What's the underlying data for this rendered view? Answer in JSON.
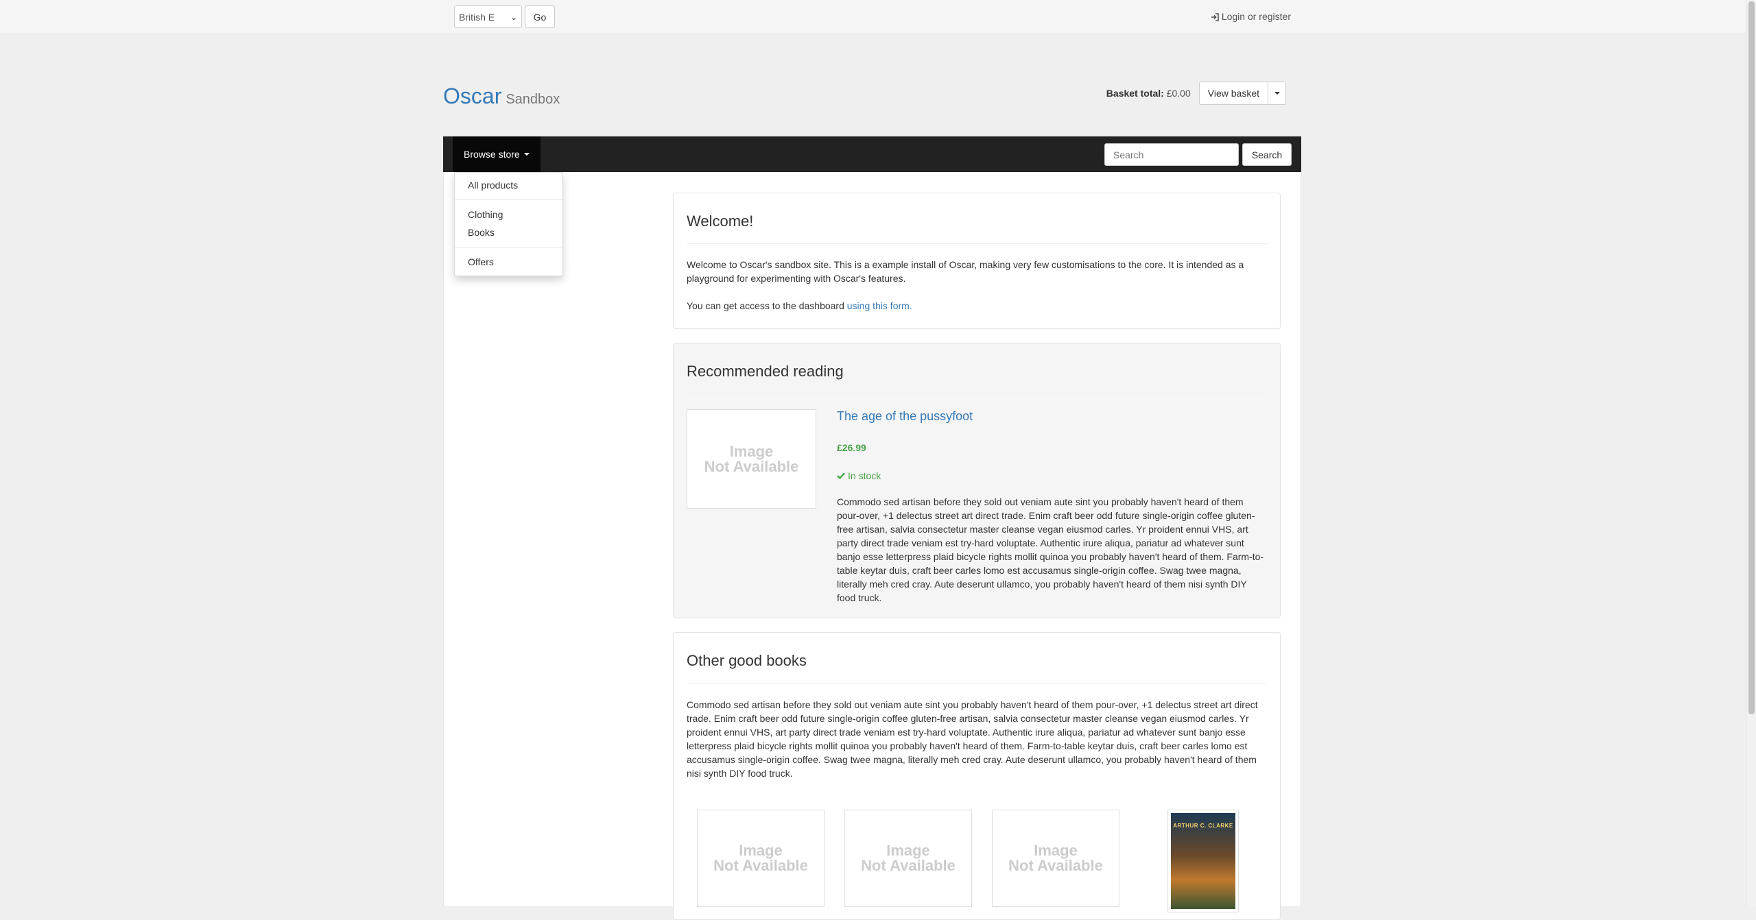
{
  "topbar": {
    "language": "British E",
    "go_label": "Go",
    "login_label": "Login or register"
  },
  "brand": {
    "title": "Oscar",
    "subtitle": "Sandbox"
  },
  "basket": {
    "total_label": "Basket total:",
    "total_value": "£0.00",
    "view_label": "View basket"
  },
  "navbar": {
    "browse_label": "Browse store",
    "search_placeholder": "Search",
    "search_button": "Search"
  },
  "dropdown": {
    "items": [
      "All products",
      "Clothing",
      "Books",
      "Offers"
    ]
  },
  "welcome": {
    "heading": "Welcome!",
    "paragraph": "Welcome to Oscar's sandbox site.  This is a example install of Oscar, making very few customisations to the core.  It is intended as a playground for experimenting with Oscar's features.",
    "access_text": "You can get access to the dashboard ",
    "access_link": "using this form."
  },
  "recommended": {
    "heading": "Recommended reading",
    "image_text_1": "Image",
    "image_text_2": "Not Available",
    "product_title": "The age of the pussyfoot",
    "price": "£26.99",
    "stock": "In stock",
    "description": "Commodo sed artisan before they sold out veniam aute sint you probably haven't heard of them pour-over, +1 delectus street art direct trade. Enim craft beer odd future single-origin coffee gluten-free artisan, salvia consectetur master cleanse vegan eiusmod carles. Yr proident ennui VHS, art party direct trade veniam est try-hard voluptate. Authentic irure aliqua, pariatur ad whatever sunt banjo esse letterpress plaid bicycle rights mollit quinoa you probably haven't heard of them. Farm-to-table keytar duis, craft beer carles lomo est accusamus single-origin coffee. Swag twee magna, literally meh cred cray. Aute deserunt ullamco, you probably haven't heard of them nisi synth DIY food truck."
  },
  "other": {
    "heading": "Other good books",
    "description": "Commodo sed artisan before they sold out veniam aute sint you probably haven't heard of them pour-over, +1 delectus street art direct trade. Enim craft beer odd future single-origin coffee gluten-free artisan, salvia consectetur master cleanse vegan eiusmod carles. Yr proident ennui VHS, art party direct trade veniam est try-hard voluptate. Authentic irure aliqua, pariatur ad whatever sunt banjo esse letterpress plaid bicycle rights mollit quinoa you probably haven't heard of them. Farm-to-table keytar duis, craft beer carles lomo est accusamus single-origin coffee. Swag twee magna, literally meh cred cray. Aute deserunt ullamco, you probably haven't heard of them nisi synth DIY food truck.",
    "cover_author": "ARTHUR C. CLARKE"
  },
  "colors": {
    "link": "#337ab7",
    "success": "#47a447",
    "navbar": "#222222"
  }
}
